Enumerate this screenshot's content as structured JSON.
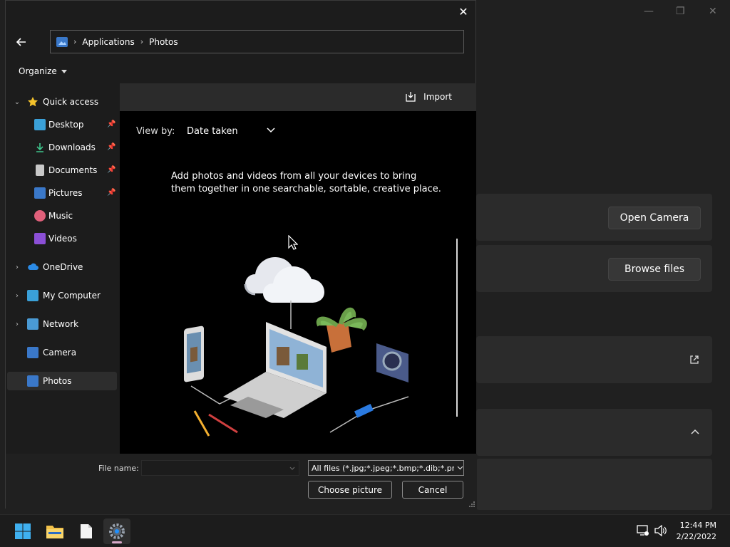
{
  "settings_window": {
    "controls": {
      "minimize": "—",
      "maximize": "❐",
      "close": "✕"
    },
    "open_camera_label": "Open Camera",
    "browse_files_label": "Browse files"
  },
  "dialog": {
    "close_glyph": "✕",
    "breadcrumb": [
      "Applications",
      "Photos"
    ],
    "organize_label": "Organize",
    "nav": {
      "items": [
        {
          "label": "Quick access"
        },
        {
          "label": "Desktop"
        },
        {
          "label": "Downloads"
        },
        {
          "label": "Documents"
        },
        {
          "label": "Pictures"
        },
        {
          "label": "Music"
        },
        {
          "label": "Videos"
        },
        {
          "label": "OneDrive"
        },
        {
          "label": "My Computer"
        },
        {
          "label": "Network"
        },
        {
          "label": "Camera"
        },
        {
          "label": "Photos"
        }
      ]
    },
    "content": {
      "import_label": "Import",
      "view_by_label": "View by:",
      "view_by_value": "Date taken",
      "message": "Add photos and videos from all your devices to bring them together in one searchable, sortable, creative place."
    },
    "bottom": {
      "file_name_label": "File name:",
      "file_name_value": "",
      "filter_value": "All files (*.jpg;*.jpeg;*.bmp;*.dib;*.png",
      "choose_label": "Choose picture",
      "cancel_label": "Cancel"
    }
  },
  "taskbar": {
    "time": "12:44 PM",
    "date": "2/22/2022"
  },
  "colors": {
    "accent": "#3a78c9",
    "dialog_bg": "#1c1c1c",
    "content_bg": "#000000"
  }
}
